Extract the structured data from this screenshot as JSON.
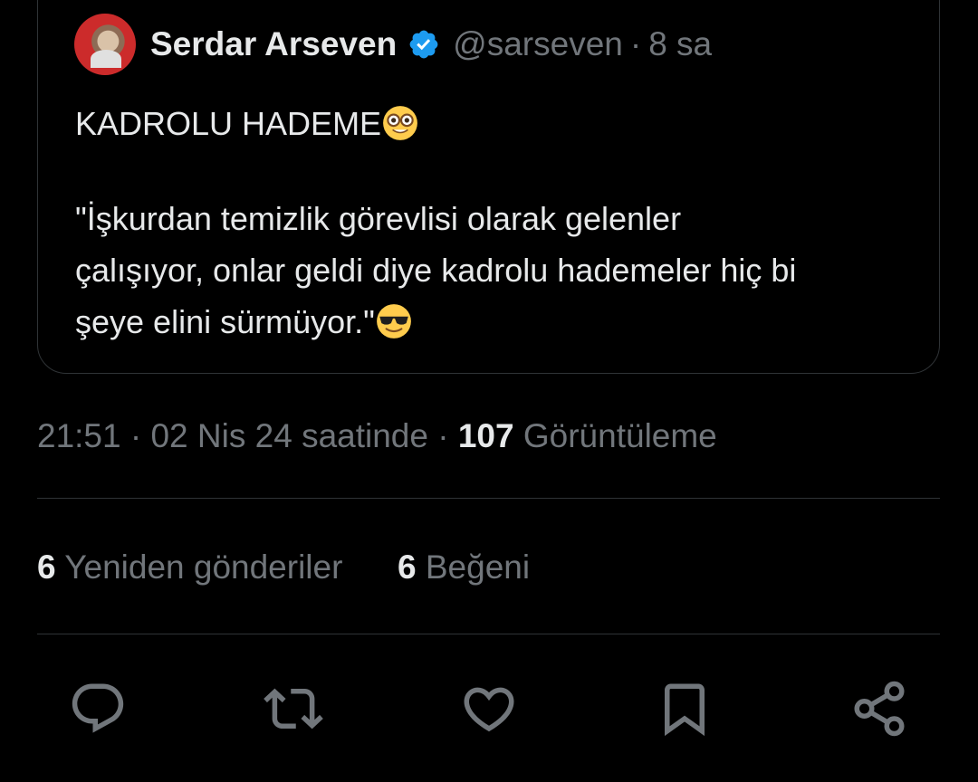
{
  "author": {
    "name": "Serdar Arseven",
    "handle": "@sarseven",
    "separator": "·",
    "time_ago": "8 sa",
    "verified_icon": "verified-badge-icon",
    "verified_color": "#1d9bf0"
  },
  "tweet": {
    "line1": "KADROLU HADEME",
    "line1_emoji": "nerd-face-emoji",
    "line2": "\"İşkurdan temizlik görevlisi olarak gelenler",
    "line3": "çalışıyor,  onlar geldi diye kadrolu hademeler hiç bi",
    "line4": "şeye elini sürmüyor.\"",
    "line4_emoji": "sunglasses-face-emoji"
  },
  "meta": {
    "time": "21:51",
    "sep1": "·",
    "date": "02 Nis 24 saatinde",
    "sep2": "·",
    "views_count": "107",
    "views_label": "Görüntüleme"
  },
  "stats": {
    "retweets_count": "6",
    "retweets_label": "Yeniden gönderiler",
    "likes_count": "6",
    "likes_label": "Beğeni"
  },
  "actions": [
    {
      "icon": "reply-icon"
    },
    {
      "icon": "retweet-icon"
    },
    {
      "icon": "like-heart-icon"
    },
    {
      "icon": "bookmark-icon"
    },
    {
      "icon": "share-icon"
    }
  ],
  "colors": {
    "background": "#000000",
    "text_primary": "#e7e9ea",
    "text_secondary": "#71767b",
    "border": "#2f3336",
    "accent": "#1d9bf0"
  }
}
